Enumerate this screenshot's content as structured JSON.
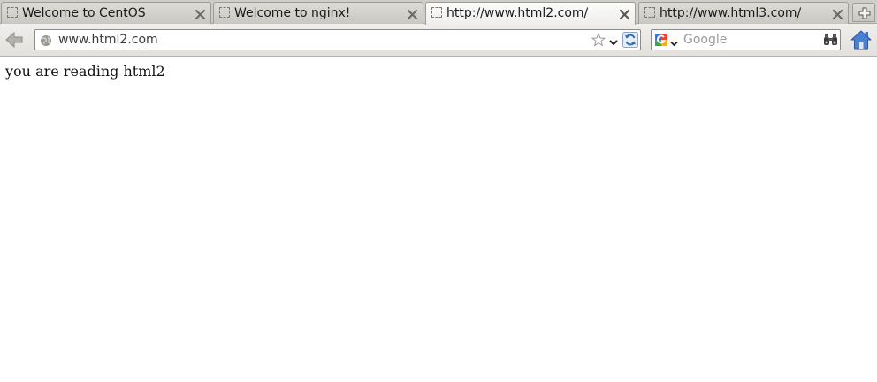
{
  "browser": {
    "tabs": [
      {
        "title": "Welcome to CentOS",
        "active": false
      },
      {
        "title": "Welcome to nginx!",
        "active": false
      },
      {
        "title": "http://www.html2.com/",
        "active": true
      },
      {
        "title": "http://www.html3.com/",
        "active": false
      }
    ],
    "icons": {
      "tab_favicon": "blank-page-icon",
      "tab_close": "close-x-icon",
      "new_tab": "plus-icon",
      "back": "back-arrow-icon",
      "site_identity": "globe-icon",
      "bookmark": "star-icon",
      "history": "chevron-down-icon",
      "reload": "reload-icon",
      "search_engine": "google-icon",
      "search_go": "binoculars-icon",
      "home": "home-icon"
    }
  },
  "navbar": {
    "url": "www.html2.com",
    "search_placeholder": "Google"
  },
  "page": {
    "text": "you are reading html2"
  },
  "colors": {
    "home_blue": "#3a6fc4",
    "reload_blue": "#2f6fb8",
    "back_gray": "#9d9b96"
  }
}
